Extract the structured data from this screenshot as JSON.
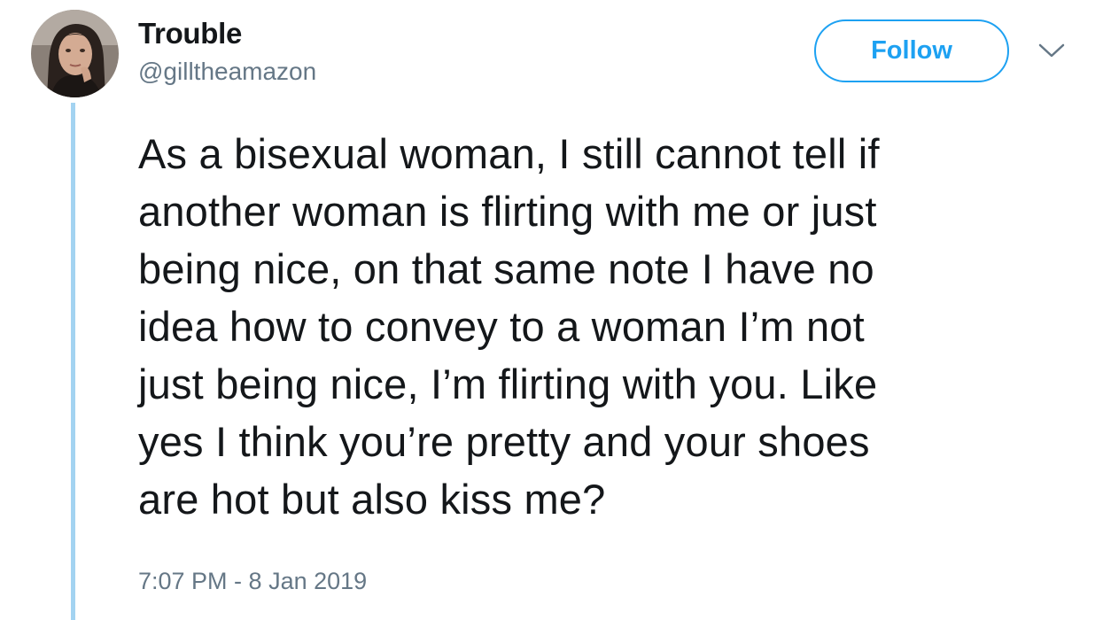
{
  "user": {
    "display_name": "Trouble",
    "handle": "@gilltheamazon",
    "avatar_icon": "profile-photo"
  },
  "actions": {
    "follow_label": "Follow",
    "menu_icon": "chevron-down-icon"
  },
  "tweet": {
    "text": "As a bisexual woman, I still cannot tell if\nanother woman is flirting with me or just\nbeing nice, on that same note I have no\nidea how to convey to a woman I’m not\njust being nice, I’m flirting with you. Like\nyes I think you’re pretty and your shoes\nare hot but also kiss me?",
    "timestamp": "7:07 PM - 8 Jan 2019"
  },
  "colors": {
    "accent": "#1da1f2",
    "thread_line": "#a3d3f1",
    "secondary_text": "#657786",
    "primary_text": "#14171a"
  }
}
